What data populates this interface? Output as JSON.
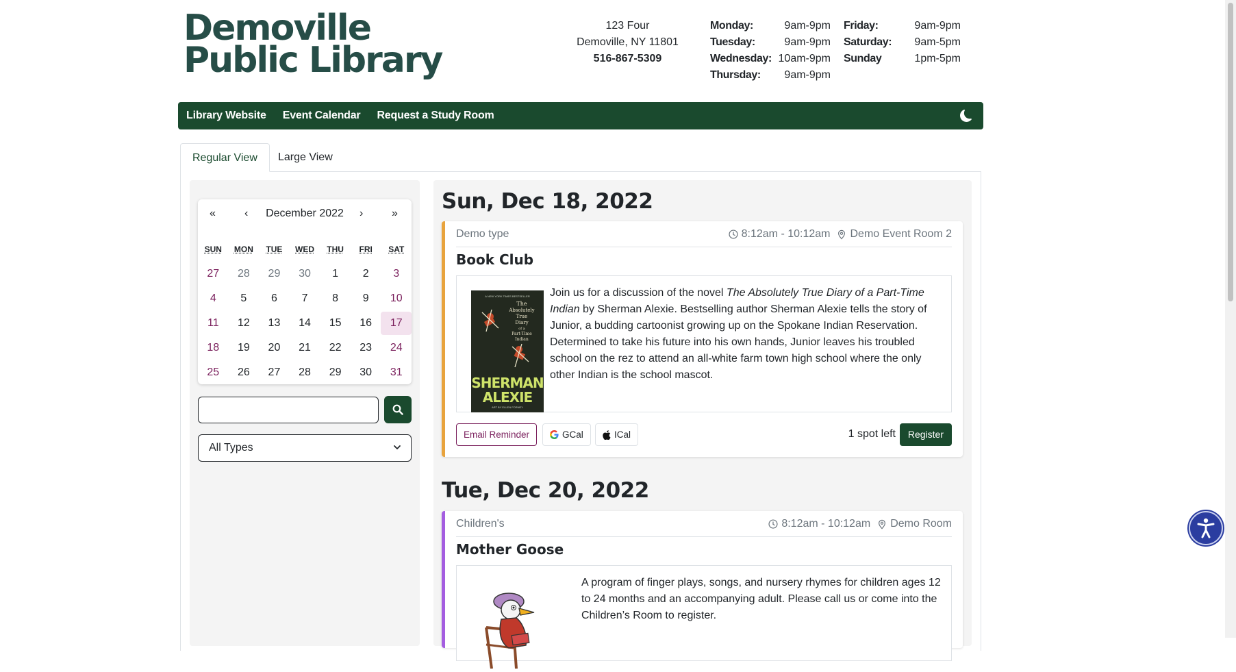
{
  "header": {
    "logo_line1": "Demoville",
    "logo_line2": "Public Library",
    "address_line1": "123 Four",
    "address_line2": "Demoville, NY 11801",
    "phone": "516-867-5309",
    "hours_col1": [
      {
        "day": "Monday:",
        "time": "9am-9pm"
      },
      {
        "day": "Tuesday:",
        "time": "9am-9pm"
      },
      {
        "day": "Wednesday:",
        "time": "10am-9pm"
      },
      {
        "day": "Thursday:",
        "time": "9am-9pm"
      }
    ],
    "hours_col2": [
      {
        "day": "Friday:",
        "time": "9am-9pm"
      },
      {
        "day": "Saturday:",
        "time": "9am-5pm"
      },
      {
        "day": "Sunday",
        "time": "1pm-5pm"
      }
    ]
  },
  "nav": {
    "items": [
      "Library Website",
      "Event Calendar",
      "Request a Study Room"
    ],
    "theme_icon": "moon-icon"
  },
  "tabs": {
    "regular": "Regular View",
    "large": "Large View"
  },
  "calendar": {
    "first": "«",
    "prev": "‹",
    "month_label": "December 2022",
    "next": "›",
    "last": "»",
    "weekdays": [
      "SUN",
      "MON",
      "TUE",
      "WED",
      "THU",
      "FRI",
      "SAT"
    ],
    "weeks": [
      [
        "27",
        "28",
        "29",
        "30",
        "1",
        "2",
        "3"
      ],
      [
        "4",
        "5",
        "6",
        "7",
        "8",
        "9",
        "10"
      ],
      [
        "11",
        "12",
        "13",
        "14",
        "15",
        "16",
        "17"
      ],
      [
        "18",
        "19",
        "20",
        "21",
        "22",
        "23",
        "24"
      ],
      [
        "25",
        "26",
        "27",
        "28",
        "29",
        "30",
        "31"
      ]
    ],
    "selected_day": "17"
  },
  "filters": {
    "search_value": "",
    "search_icon": "search-icon",
    "type_selected": "All Types"
  },
  "days": [
    {
      "date": "Sun, Dec 18, 2022",
      "event": {
        "type": "Demo type",
        "time": "8:12am - 10:12am",
        "location": "Demo Event Room 2",
        "title": "Book Club",
        "desc_pre": "Join us for a discussion of the novel ",
        "desc_italic": "The Absolutely True Diary of a Part-Time Indian",
        "desc_post": " by Sherman Alexie.  Bestselling author Sherman Alexie tells the story of Junior, a budding cartoonist growing up on the Spokane Indian Reservation. Determined to take his future into his own hands, Junior leaves his troubled school on the rez to attend an all-white farm town high school where the only other Indian is the school mascot.",
        "book_title": "The Absolutely True Diary of a Part-Time Indian",
        "book_author_line1": "SHERMAN",
        "book_author_line2": "ALEXIE",
        "email_reminder": "Email Reminder",
        "gcal": "GCal",
        "ical": "ICal",
        "spots": "1 spot left",
        "register": "Register",
        "accent": "#e8a33d"
      }
    },
    {
      "date": "Tue, Dec 20, 2022",
      "event": {
        "type": "Children's",
        "time": "8:12am - 10:12am",
        "location": "Demo Room",
        "title": "Mother Goose",
        "description": "A program of finger plays, songs, and nursery rhymes for children ages 12 to 24 months and an accompanying adult.  Please call us or come into the Children’s Room to register.",
        "accent": "#a45de0"
      }
    }
  ],
  "colors": {
    "brand_green": "#1a4a2e",
    "logo_teal": "#264d47",
    "weekend": "#7a1f5c",
    "accessibility": "#2b3da0"
  },
  "accessibility_icon": "accessibility-icon"
}
